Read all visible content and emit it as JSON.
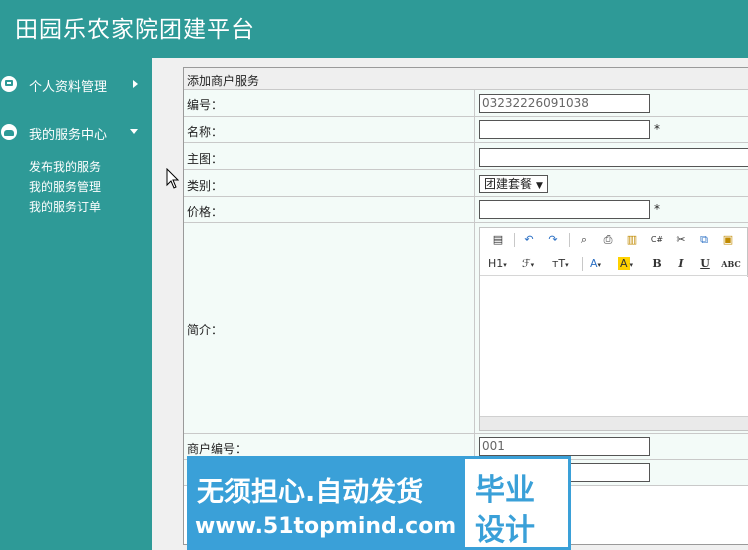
{
  "app_title": "田园乐农家院团建平台",
  "sidebar": {
    "sections": [
      {
        "label": "个人资料管理",
        "icon": "monitor-icon",
        "expanded": false
      },
      {
        "label": "我的服务中心",
        "icon": "home-icon",
        "expanded": true
      }
    ],
    "items": [
      "发布我的服务",
      "我的服务管理",
      "我的服务订单"
    ]
  },
  "form": {
    "title": "添加商户服务",
    "fields": {
      "code": {
        "label": "编号：",
        "value": "03232226091038"
      },
      "name": {
        "label": "名称：",
        "value": "",
        "required_mark": "*"
      },
      "image": {
        "label": "主图：",
        "value": ""
      },
      "category": {
        "label": "类别：",
        "value": "团建套餐"
      },
      "price": {
        "label": "价格：",
        "value": "",
        "required_mark": "*"
      },
      "intro": {
        "label": "简介："
      },
      "merchant_code": {
        "label": "商户编号：",
        "value": "001"
      }
    }
  },
  "editor_toolbar": {
    "row1": [
      "template-icon",
      "undo-icon",
      "redo-icon",
      "preview-icon",
      "print-icon",
      "select-all-icon",
      "code-icon",
      "cut-icon",
      "copy-icon",
      "paste-icon"
    ],
    "row2": [
      {
        "name": "heading-icon",
        "text": "H1"
      },
      {
        "name": "font-family-icon",
        "text": "ℱ"
      },
      {
        "name": "font-size-icon",
        "text": "тT"
      },
      {
        "name": "font-color-icon",
        "text": "A"
      },
      {
        "name": "highlight-icon",
        "text": "A"
      },
      {
        "name": "bold-icon",
        "text": "B"
      },
      {
        "name": "italic-icon",
        "text": "I"
      },
      {
        "name": "underline-icon",
        "text": "U"
      },
      {
        "name": "strikethrough-icon",
        "text": "ABC"
      }
    ]
  },
  "watermark": {
    "line1": "无须担心.自动发货",
    "line2": "www.51topmind.com",
    "badge_top": "毕业",
    "badge_bottom": "设计"
  },
  "colors": {
    "header_bg": "#2e9a97",
    "form_row_bg": "#f3fbf8",
    "watermark_bg": "#3aa0d8"
  }
}
